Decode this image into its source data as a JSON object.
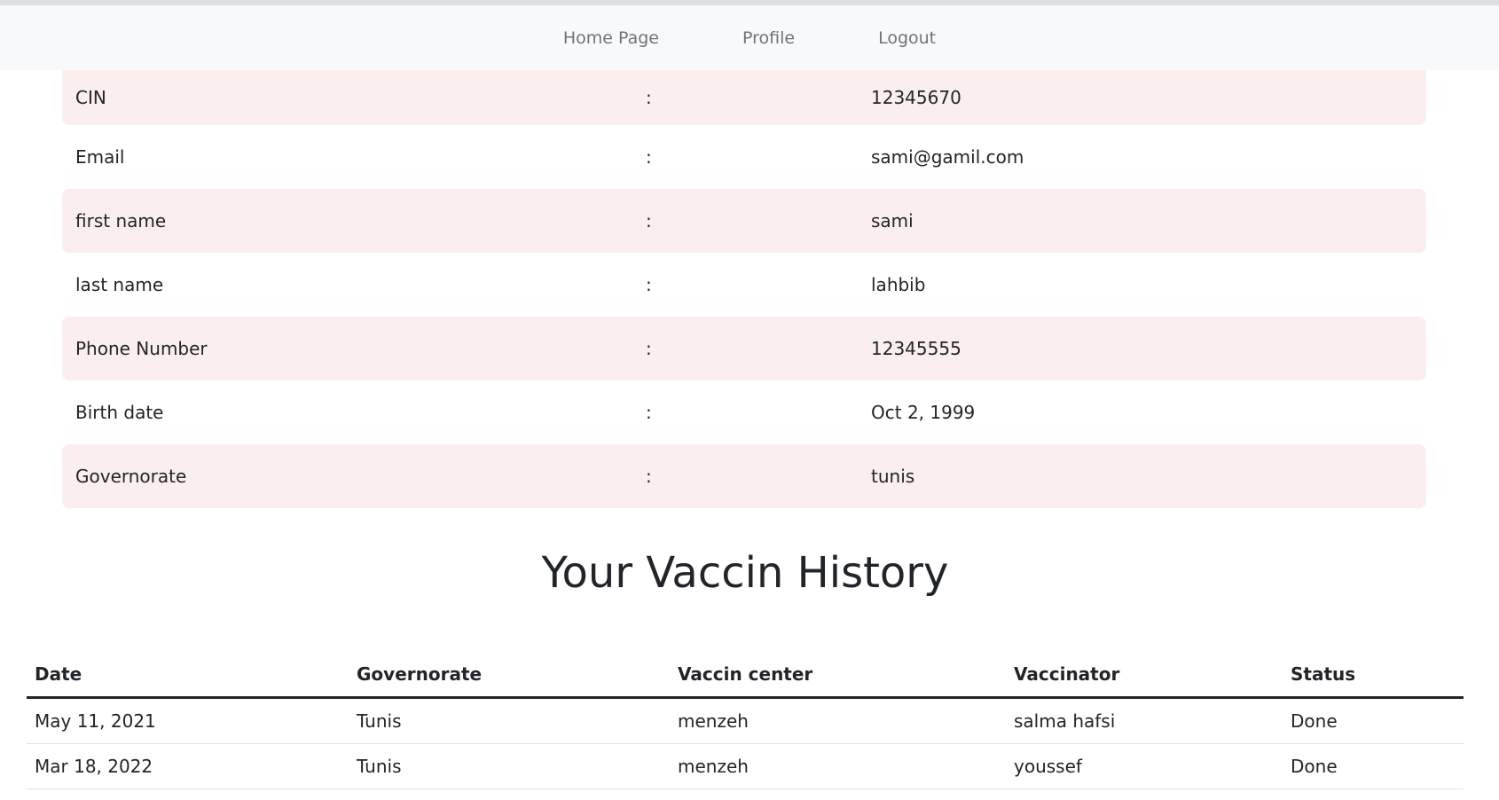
{
  "nav": {
    "items": [
      "Home Page",
      "Profile",
      "Logout"
    ]
  },
  "profile": {
    "separator": ":",
    "rows": [
      {
        "label": "CIN",
        "value": "12345670"
      },
      {
        "label": "Email",
        "value": "sami@gamil.com"
      },
      {
        "label": "first name",
        "value": "sami"
      },
      {
        "label": "last name",
        "value": "lahbib"
      },
      {
        "label": "Phone Number",
        "value": "12345555"
      },
      {
        "label": "Birth date",
        "value": "Oct 2, 1999"
      },
      {
        "label": "Governorate",
        "value": "tunis"
      }
    ]
  },
  "history": {
    "title": "Your Vaccin History",
    "columns": [
      "Date",
      "Governorate",
      "Vaccin center",
      "Vaccinator",
      "Status"
    ],
    "rows": [
      [
        "May 11, 2021",
        "Tunis",
        "menzeh",
        "salma hafsi",
        "Done"
      ],
      [
        "Mar 18, 2022",
        "Tunis",
        "menzeh",
        "youssef",
        "Done"
      ]
    ]
  },
  "colors": {
    "navbar_bg": "#f8f9fa",
    "row_shade": "#fbeeee",
    "text": "#212529",
    "nav_text": "#6c757d"
  }
}
